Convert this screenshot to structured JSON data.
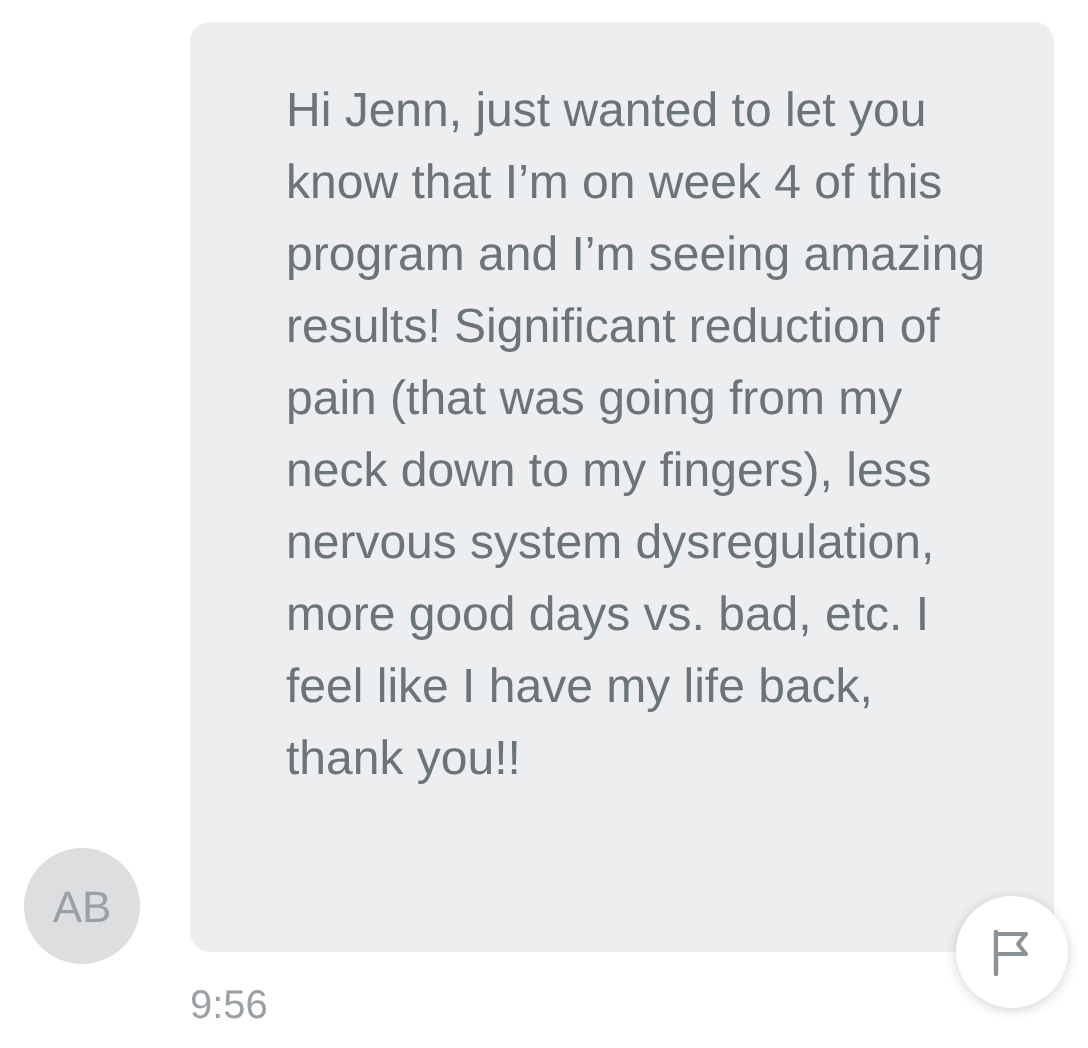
{
  "message": {
    "avatar": "AB",
    "text": "Hi Jenn, just wanted to let you know that I’m on week 4 of this program and I’m seeing amazing results! Significant reduction of pain (that was going from my neck down to my fingers), less nervous system dysregulation, more good days vs. bad, etc. I feel like I have my life back, thank you!!",
    "time": "9:56"
  }
}
